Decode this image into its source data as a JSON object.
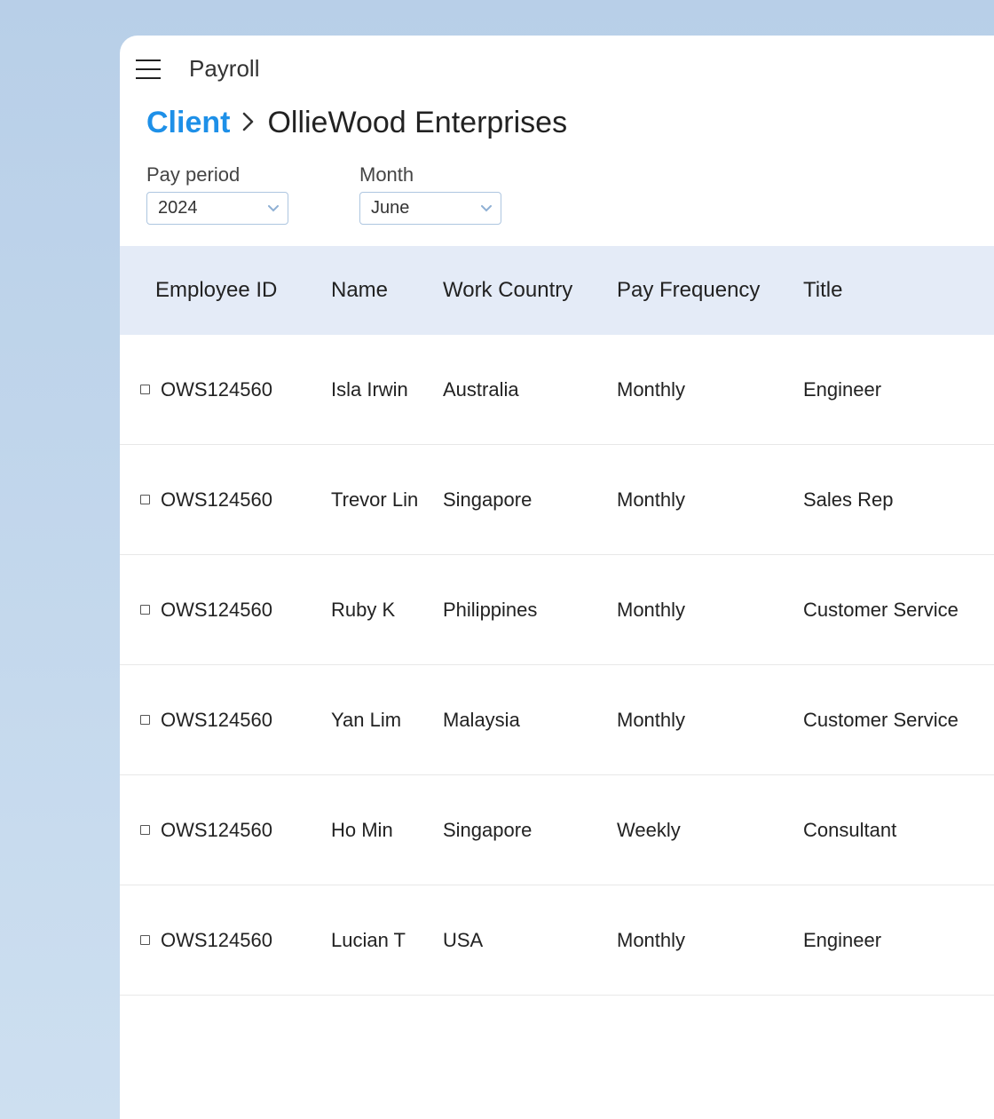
{
  "header": {
    "page_title": "Payroll"
  },
  "breadcrumb": {
    "link_label": "Client",
    "current": "OllieWood Enterprises"
  },
  "filters": {
    "pay_period": {
      "label": "Pay period",
      "value": "2024"
    },
    "month": {
      "label": "Month",
      "value": "June"
    }
  },
  "table": {
    "columns": {
      "employee_id": "Employee ID",
      "name": "Name",
      "work_country": "Work Country",
      "pay_frequency": "Pay Frequency",
      "title": "Title"
    },
    "rows": [
      {
        "employee_id": "OWS124560",
        "name": "Isla Irwin",
        "work_country": "Australia",
        "pay_frequency": "Monthly",
        "title": "Engineer"
      },
      {
        "employee_id": "OWS124560",
        "name": "Trevor Lin",
        "work_country": "Singapore",
        "pay_frequency": "Monthly",
        "title": "Sales Rep"
      },
      {
        "employee_id": "OWS124560",
        "name": "Ruby K",
        "work_country": "Philippines",
        "pay_frequency": "Monthly",
        "title": "Customer Service"
      },
      {
        "employee_id": "OWS124560",
        "name": "Yan Lim",
        "work_country": "Malaysia",
        "pay_frequency": "Monthly",
        "title": "Customer Service"
      },
      {
        "employee_id": "OWS124560",
        "name": "Ho Min",
        "work_country": "Singapore",
        "pay_frequency": "Weekly",
        "title": "Consultant"
      },
      {
        "employee_id": "OWS124560",
        "name": "Lucian T",
        "work_country": "USA",
        "pay_frequency": "Monthly",
        "title": "Engineer"
      }
    ]
  }
}
